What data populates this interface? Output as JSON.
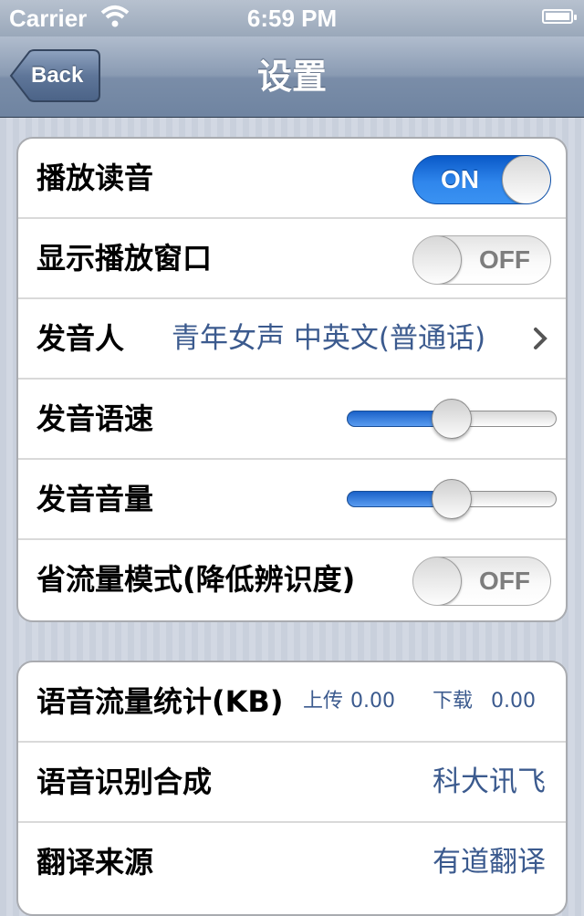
{
  "status_bar": {
    "carrier": "Carrier",
    "wifi_icon": "wifi-icon",
    "time": "6:59 PM",
    "battery_icon": "battery-icon"
  },
  "nav": {
    "back_label": "Back",
    "title": "设置"
  },
  "settings": {
    "play_audio": {
      "label": "播放读音",
      "state": "ON"
    },
    "show_window": {
      "label": "显示播放窗口",
      "state": "OFF"
    },
    "speaker": {
      "label": "发音人",
      "value": "青年女声 中英文(普通话)"
    },
    "speed": {
      "label": "发音语速",
      "level": 0.5
    },
    "volume": {
      "label": "发音音量",
      "level": 0.5
    },
    "data_saver": {
      "label": "省流量模式(降低辨识度)",
      "state": "OFF"
    }
  },
  "stats": {
    "traffic": {
      "label": "语音流量统计(KB)",
      "upload_label": "上传",
      "upload_value": "0.00",
      "download_label": "下载",
      "download_value": "0.00"
    },
    "recognition": {
      "label": "语音识别合成",
      "value": "科大讯飞"
    },
    "translation": {
      "label": "翻译来源",
      "value": "有道翻译"
    }
  },
  "colors": {
    "accent": "#3b5a8e",
    "toggle_on": "#2f86ec",
    "nav": "#8a9bb3"
  }
}
